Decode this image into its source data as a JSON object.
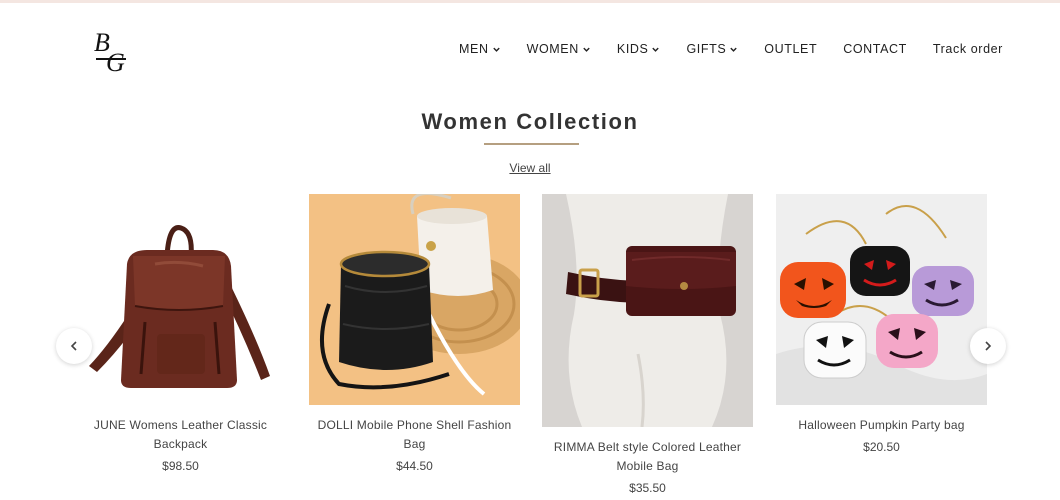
{
  "header": {
    "logo_text": "BG",
    "nav": [
      {
        "label": "MEN",
        "has_dropdown": true,
        "icon": "chevron-down-icon"
      },
      {
        "label": "WOMEN",
        "has_dropdown": true,
        "icon": "chevron-down-icon"
      },
      {
        "label": "KIDS",
        "has_dropdown": true,
        "icon": "chevron-down-icon"
      },
      {
        "label": "GIFTS",
        "has_dropdown": true,
        "icon": "chevron-down-icon"
      },
      {
        "label": "OUTLET",
        "has_dropdown": false
      },
      {
        "label": "CONTACT",
        "has_dropdown": false
      },
      {
        "label": "Track order",
        "has_dropdown": false
      }
    ]
  },
  "section": {
    "title": "Women Collection",
    "view_all": "View all",
    "accent_color": "#b59f80"
  },
  "products": [
    {
      "name": "JUNE Womens Leather Classic Backpack",
      "price": "$98.50",
      "image": "brown-leather-backpack"
    },
    {
      "name": "DOLLI Mobile Phone Shell Fashion Bag",
      "price": "$44.50",
      "image": "black-crossbody-bucket-bag"
    },
    {
      "name": "RIMMA Belt style Colored Leather Mobile Bag",
      "price": "$35.50",
      "image": "burgundy-belt-bag"
    },
    {
      "name": "Halloween Pumpkin Party bag",
      "price": "$20.50",
      "image": "pumpkin-bags"
    }
  ],
  "carousel": {
    "prev_icon": "chevron-left-icon",
    "next_icon": "chevron-right-icon"
  }
}
